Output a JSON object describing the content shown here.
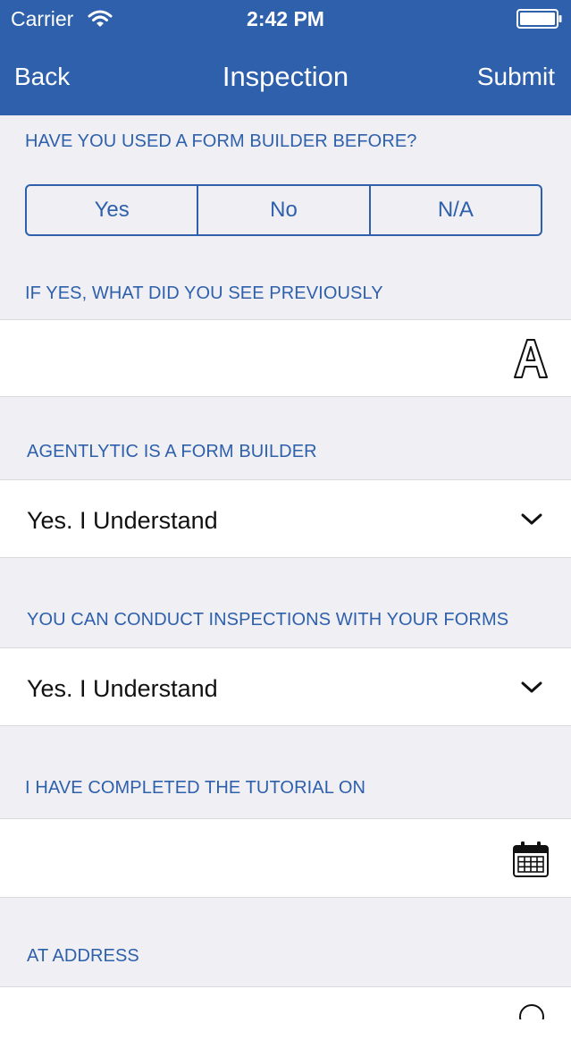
{
  "status_bar": {
    "carrier": "Carrier",
    "time": "2:42 PM",
    "wifi_icon": "wifi-icon",
    "battery_icon": "battery-icon"
  },
  "nav": {
    "back_label": "Back",
    "title": "Inspection",
    "submit_label": "Submit"
  },
  "form": {
    "q1": {
      "label": "HAVE YOU USED A FORM BUILDER BEFORE?",
      "options": [
        "Yes",
        "No",
        "N/A"
      ]
    },
    "q2": {
      "label": "IF YES, WHAT DID YOU SEE PREVIOUSLY",
      "value": "",
      "icon": "text-input-icon"
    },
    "q3": {
      "label": "AGENTLYTIC IS A FORM BUILDER",
      "value": "Yes. I Understand",
      "icon": "chevron-down-icon"
    },
    "q4": {
      "label": "YOU CAN CONDUCT INSPECTIONS WITH YOUR FORMS",
      "value": "Yes. I Understand",
      "icon": "chevron-down-icon"
    },
    "q5": {
      "label": "I HAVE COMPLETED THE TUTORIAL ON",
      "value": "",
      "icon": "calendar-icon"
    },
    "q6": {
      "label": "AT ADDRESS",
      "value": "",
      "icon": "location-icon"
    }
  },
  "colors": {
    "accent": "#2e60ab",
    "background": "#efeff4",
    "row_background": "#ffffff",
    "text": "#111111"
  }
}
